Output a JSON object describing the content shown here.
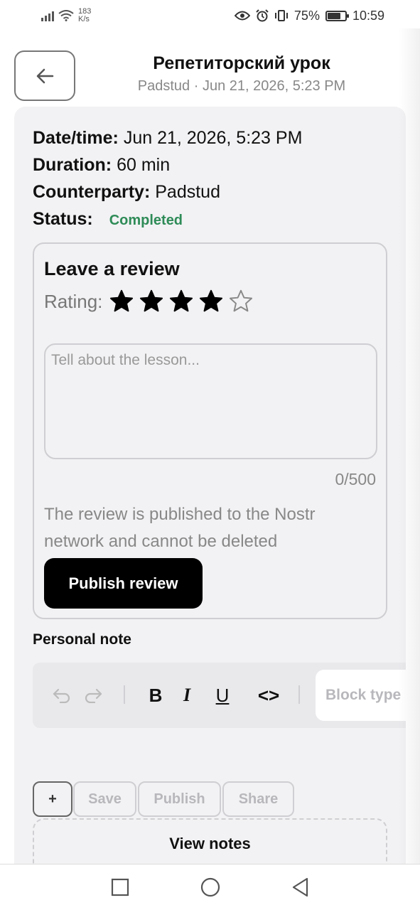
{
  "status_bar": {
    "net_speed_value": "183",
    "net_speed_unit": "K/s",
    "battery": "75%",
    "time": "10:59",
    "battery_level": 0.75
  },
  "header": {
    "title": "Репетиторский урок",
    "subtitle": "Padstud · Jun 21, 2026, 5:23 PM"
  },
  "details": {
    "datetime_label": "Date/time:",
    "datetime_value": "Jun 21, 2026, 5:23 PM",
    "duration_label": "Duration:",
    "duration_value": "60 min",
    "counterparty_label": "Counterparty:",
    "counterparty_value": "Padstud",
    "status_label": "Status:",
    "status_value": "Completed",
    "status_color": "#2e8b57"
  },
  "review": {
    "title": "Leave a review",
    "rating_label": "Rating:",
    "rating": 4,
    "rating_max": 5,
    "placeholder": "Tell about the lesson...",
    "char_count": "0/500",
    "note": "The review is published to the Nostr network and cannot be deleted",
    "publish_label": "Publish review"
  },
  "personal_note": {
    "label": "Personal note",
    "toolbar": {
      "icons": [
        "undo-icon",
        "redo-icon",
        "bold-icon",
        "italic-icon",
        "underline-icon",
        "code-icon"
      ],
      "bold": "B",
      "italic": "I",
      "underline": "U",
      "code": "<>",
      "block_type": "Block type"
    }
  },
  "actions": {
    "plus": "+",
    "save": "Save",
    "publish": "Publish",
    "share": "Share",
    "view_notes": "View notes"
  },
  "nav": {
    "icons": [
      "recents-icon",
      "home-icon",
      "back-icon"
    ]
  }
}
